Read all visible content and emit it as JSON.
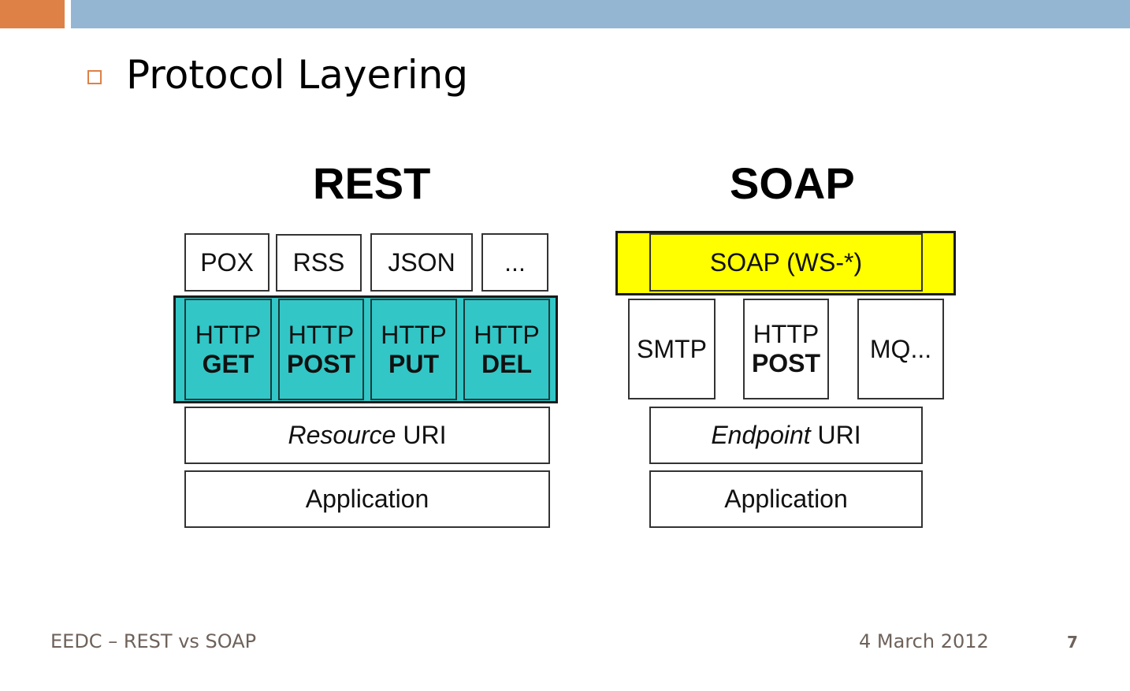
{
  "slide": {
    "title": "Protocol Layering",
    "footer_left": "EEDC – REST vs SOAP",
    "footer_date": "4 March 2012",
    "page_number": "7",
    "colors": {
      "accent_orange": "#de8147",
      "accent_blue": "#94b6d2",
      "teal": "#33c6c6",
      "yellow": "#ffff00"
    }
  },
  "rest": {
    "heading": "REST",
    "formats": [
      "POX",
      "RSS",
      "JSON",
      "..."
    ],
    "methods": [
      {
        "line1": "HTTP",
        "line2": "GET"
      },
      {
        "line1": "HTTP",
        "line2": "POST"
      },
      {
        "line1": "HTTP",
        "line2": "PUT"
      },
      {
        "line1": "HTTP",
        "line2": "DEL"
      }
    ],
    "uri_italic": "Resource",
    "uri_text": " URI",
    "application": "Application"
  },
  "soap": {
    "heading": "SOAP",
    "envelope": "SOAP (WS-*)",
    "transports": [
      {
        "line1": "SMTP",
        "line2": ""
      },
      {
        "line1": "HTTP",
        "line2": "POST"
      },
      {
        "line1": "MQ...",
        "line2": ""
      }
    ],
    "uri_italic": "Endpoint",
    "uri_text": " URI",
    "application": "Application"
  }
}
